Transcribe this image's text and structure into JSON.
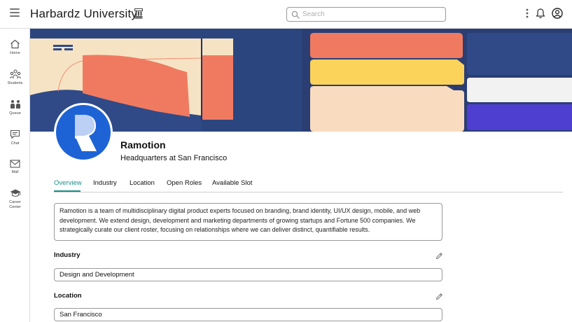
{
  "header": {
    "app_title": "Harbardz University",
    "search_placeholder": "Search"
  },
  "sidebar": {
    "items": [
      {
        "label": "Home",
        "icon": "home-icon"
      },
      {
        "label": "Students",
        "icon": "students-icon"
      },
      {
        "label": "Queue",
        "icon": "queue-icon"
      },
      {
        "label": "Chat",
        "icon": "chat-icon"
      },
      {
        "label": "Mail",
        "icon": "mail-icon"
      },
      {
        "label": "Career Center",
        "icon": "career-center-icon"
      }
    ]
  },
  "company": {
    "name": "Ramotion",
    "subtitle": "Headquarters at San Francisco",
    "brand_color": "#1d63d6"
  },
  "tabs": [
    {
      "label": "Overview",
      "active": true
    },
    {
      "label": "Industry",
      "active": false
    },
    {
      "label": "Location",
      "active": false
    },
    {
      "label": "Open Roles",
      "active": false
    },
    {
      "label": "Available Slot",
      "active": false
    }
  ],
  "overview": {
    "description": "Ramotion is a team of multidisciplinary digital product experts focused on branding, brand identity, UI/UX design, mobile, and web development. We extend design, development and marketing departments of growing startups and Fortune 500 companies. We strategically curate our client roster, focusing on relationships where we can deliver distinct, quantifiable results."
  },
  "fields": {
    "industry": {
      "title": "Industry",
      "value": "Design and Development"
    },
    "location": {
      "title": "Location",
      "value": "San Francisco"
    }
  },
  "colors": {
    "accent": "#16908a",
    "banner_navy": "#2f4a87",
    "banner_cream": "#f6e3c3",
    "banner_coral": "#f07a60",
    "banner_yellow": "#fbd35b",
    "banner_purple": "#4f3fd1"
  }
}
